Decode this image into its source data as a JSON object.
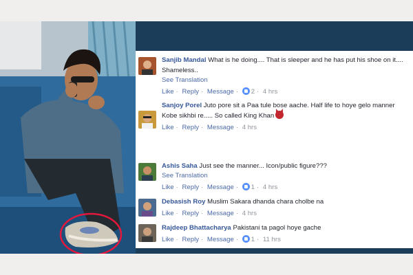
{
  "comments": [
    {
      "author": "Sanjib Mandal",
      "text": "What is he doing.... That is sleeper and he has put his shoe on it.... Shameless..",
      "see_translation": "See Translation",
      "actions": {
        "like": "Like",
        "reply": "Reply",
        "message": "Message",
        "reactions": "2",
        "time": "4 hrs"
      },
      "avatar_color": "#a5542e"
    },
    {
      "author": "Sanjoy Porel",
      "text": "Juto pore sit a Paa tule bose aache. Half life to hoye gelo manner Kobe sikhbi re..... So called King Khan",
      "emoji": "devil-emoji",
      "actions": {
        "like": "Like",
        "reply": "Reply",
        "message": "Message",
        "time": "4 hrs"
      },
      "avatar_color": "#c89a3c"
    },
    {
      "author": "Ashis Saha",
      "text": "Just see the manner... Icon/public figure???",
      "see_translation": "See Translation",
      "actions": {
        "like": "Like",
        "reply": "Reply",
        "message": "Message",
        "reactions": "1",
        "time": "4 hrs"
      },
      "avatar_color": "#4c7a3a"
    },
    {
      "author": "Debasish Roy",
      "text": "Muslim Sakara dhanda chara cholbe na",
      "actions": {
        "like": "Like",
        "reply": "Reply",
        "message": "Message",
        "time": "4 hrs"
      },
      "avatar_color": "#4a6b8f"
    },
    {
      "author": "Rajdeep Bhattacharya",
      "text": "Pakistani ta pagol hoye gache",
      "actions": {
        "like": "Like",
        "reply": "Reply",
        "message": "Message",
        "reactions": "1",
        "time": "11 hrs"
      },
      "avatar_color": "#6d6459"
    }
  ],
  "colors": {
    "link": "#365899",
    "background": "#1c3d5a",
    "like_bubble": "#5890ff"
  }
}
